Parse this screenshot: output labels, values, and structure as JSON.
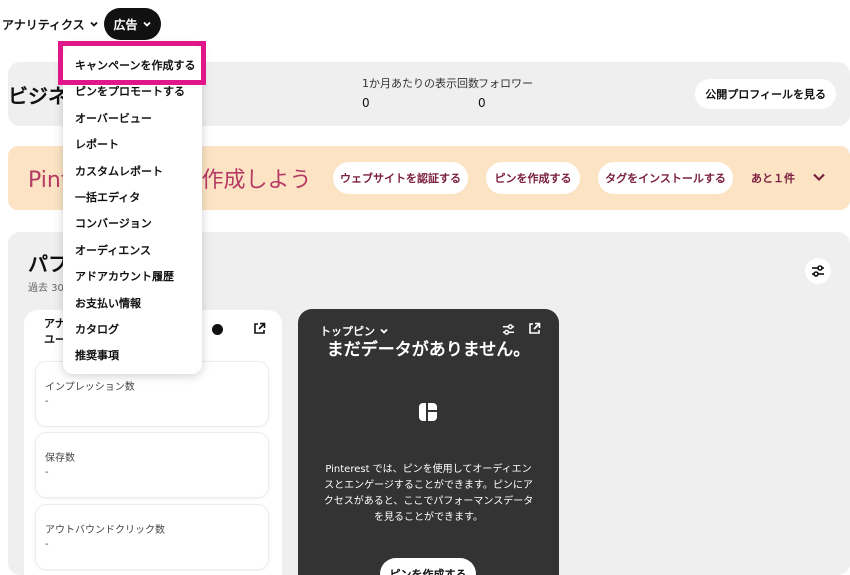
{
  "nav": {
    "analytics_label": "アナリティクス",
    "ads_label": "広告"
  },
  "profile": {
    "title": "ビジネ",
    "monthly_views_label": "1か月あたりの表示回数",
    "monthly_views_value": "0",
    "followers_label": "フォロワー",
    "followers_value": "0",
    "view_profile_label": "公開プロフィールを見る"
  },
  "banner": {
    "title": "Pint　　　　　　作成しよう",
    "buttons": [
      "ウェブサイトを認証する",
      "ピンを作成する",
      "タグをインストールする"
    ],
    "more_label": "あと１件"
  },
  "performance": {
    "title": "パフ",
    "subtitle": "過去 30",
    "analytics_panel": {
      "title_line1": "アナ",
      "title_line2": "ユー",
      "metrics": [
        {
          "label": "インプレッション数",
          "value": "-"
        },
        {
          "label": "保存数",
          "value": "-"
        },
        {
          "label": "アウトバウンドクリック数",
          "value": "-"
        }
      ]
    },
    "top_pins": {
      "label": "トップピン",
      "nodata_title": "まだデータがありません。",
      "nodata_desc": "Pinterest では、ピンを使用してオーディエンスとエンゲージすることができます。ピンにアクセスがあると、ここでパフォーマンスデータを見ることができます。",
      "create_pin_label": "ピンを作成する"
    }
  },
  "dropdown": {
    "items": [
      "キャンペーンを作成する",
      "ピンをプロモートする",
      "オーバービュー",
      "レポート",
      "カスタムレポート",
      "一括エディタ",
      "コンバージョン",
      "オーディエンス",
      "アドアカウント履歴",
      "お支払い情報",
      "カタログ",
      "推奨事項"
    ]
  },
  "colors": {
    "highlight": "#e0168a",
    "banner_bg": "#fbe3c4",
    "banner_title": "#b53a64",
    "dark_panel": "#333333"
  }
}
